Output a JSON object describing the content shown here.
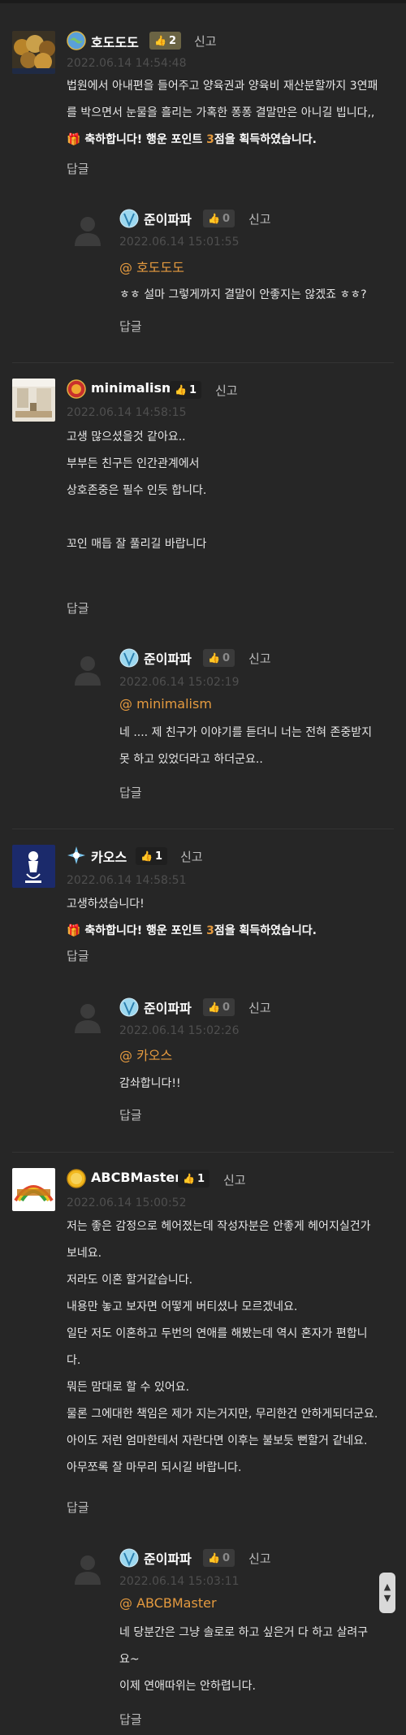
{
  "report_label": "신고",
  "reply_label": "답글",
  "reward": {
    "prefix": "축하합니다! 행운 포인트 ",
    "points": "3",
    "suffix": "점을 획득하였습니다."
  },
  "comments": [
    {
      "nick": "호도도도",
      "likes": "2",
      "time": "2022.06.14 14:54:48",
      "lines": [
        "법원에서 아내편을 들어주고 양육권과 양육비 재산분할까지 3연패",
        "를 박으면서 눈물을 흘리는 가혹한 퐁퐁 결말만은 아니길 빕니다,,"
      ],
      "reply": {
        "nick": "준이파파",
        "likes": "0",
        "time": "2022.06.14 15:01:55",
        "mention": "@ 호도도도",
        "lines": [
          "ㅎㅎ 설마 그렇게까지 결말이 안좋지는 않겠죠 ㅎㅎ?"
        ]
      }
    },
    {
      "nick": "minimalism",
      "likes": "1",
      "time": "2022.06.14 14:58:15",
      "lines": [
        "고생 많으셨을것 같아요..",
        "부부든 친구든 인간관계에서",
        "상호존중은 필수 인듯 합니다.",
        "",
        "꼬인 매듭 잘 풀리길 바랍니다"
      ],
      "reply": {
        "nick": "준이파파",
        "likes": "0",
        "time": "2022.06.14 15:02:19",
        "mention": "@ minimalism",
        "lines": [
          "네 .... 제 친구가 이야기를 듣더니   너는 전혀 존중받지",
          "못 하고 있었더라고 하더군요.."
        ]
      }
    },
    {
      "nick": "카오스",
      "likes": "1",
      "time": "2022.06.14 14:58:51",
      "lines": [
        "고생하셨습니다!"
      ],
      "reply": {
        "nick": "준이파파",
        "likes": "0",
        "time": "2022.06.14 15:02:26",
        "mention": "@ 카오스",
        "lines": [
          "감솨합니다!!"
        ]
      }
    },
    {
      "nick": "ABCBMaster",
      "likes": "1",
      "time": "2022.06.14 15:00:52",
      "lines": [
        "저는 좋은 감정으로 헤어졌는데 작성자분은 안좋게 헤어지실건가",
        "보네요.",
        "저라도 이혼 할거같습니다.",
        "내용만 놓고 보자면 어떻게 버티셨나 모르겠네요.",
        "일단 저도 이혼하고 두번의 연애를 해봤는데 역시 혼자가 편합니",
        "다.",
        "뭐든 맘대로 할 수 있어요.",
        "물론 그에대한 책임은 제가 지는거지만, 무리한건 안하게되더군요.",
        "아이도 저런 엄마한테서 자란다면 이후는 불보듯 뻔할거 같네요.",
        "아무쪼록 잘 마무리 되시길 바랍니다."
      ],
      "reply": {
        "nick": "준이파파",
        "likes": "0",
        "time": "2022.06.14 15:03:11",
        "mention": "@ ABCBMaster",
        "lines": [
          "네 당분간은 그냥 솔로로  하고 싶은거 다 하고 살려구",
          "요~",
          "이제 연애따위는 안하렵니다."
        ]
      }
    }
  ]
}
